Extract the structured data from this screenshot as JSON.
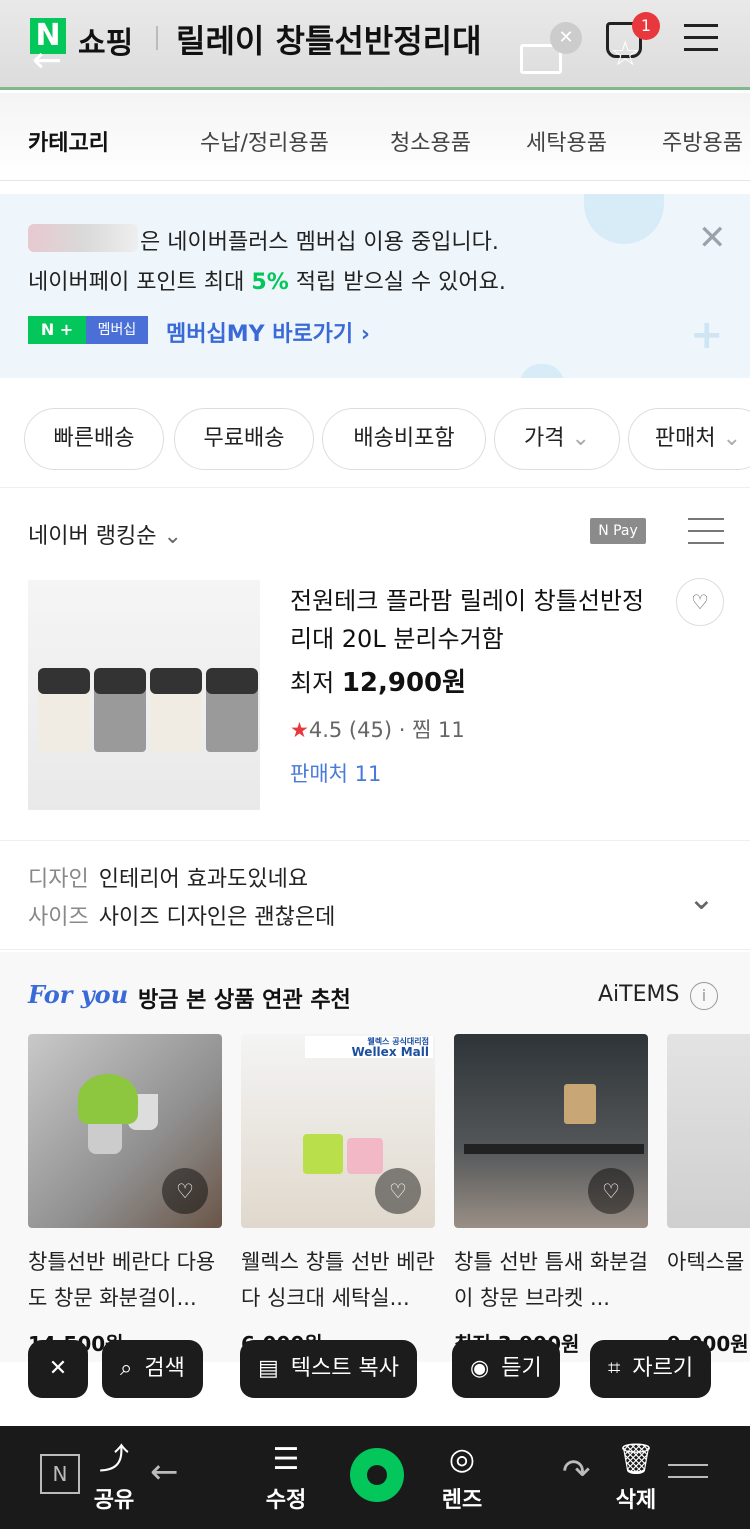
{
  "header": {
    "logo": "N",
    "shop": "쇼핑",
    "title": "릴레이 창틀선반정리대",
    "cart_count": "1",
    "cart_icon": "shopping-bag-icon",
    "accent": "#03c75a"
  },
  "categories": {
    "title": "카테고리",
    "items": [
      "수납/정리용품",
      "청소용품",
      "세탁용품",
      "주방용품"
    ]
  },
  "banner": {
    "line1": "은 네이버플러스 멤버십 이용 중입니다.",
    "line2_prefix": "네이버페이 포인트 최대",
    "line2_percent": "5%",
    "line2_suffix": "적립 받으실 수 있어요.",
    "badge_n": "N +",
    "badge_membership": "멤버십",
    "link": "멤버십MY 바로가기 ›"
  },
  "filters": [
    "빠른배송",
    "무료배송",
    "배송비포함",
    "가격",
    "판매처"
  ],
  "sort": {
    "label": "네이버 랭킹순",
    "npay": "N Pay"
  },
  "product": {
    "title": "전원테크 플라팜 릴레이 창틀선반정리대 20L 분리수거함",
    "price_label": "최저",
    "price": "12,900원",
    "rating": "4.5",
    "reviews": "(45)",
    "wish": "찜 11",
    "sellers": "판매처 11"
  },
  "reviews": [
    {
      "key": "디자인",
      "text": "인테리어 효과도있네요"
    },
    {
      "key": "사이즈",
      "text": "사이즈 디자인은 괜찮은데"
    }
  ],
  "foryou": {
    "logo": "For you",
    "title": "방금 본 상품 연관 추천",
    "brand": "AiTEMS",
    "cards": [
      {
        "title": "창틀선반 베란다 다용도 창문 화분걸이...",
        "price": "14,500원"
      },
      {
        "title": "웰렉스 창틀 선반 베란다 싱크대 세탁실...",
        "price": "6,000원"
      },
      {
        "title": "창틀 선반 틈새 화분걸이 창문 브라켓 ...",
        "price": "최저 3,990원"
      },
      {
        "title": "아텍스몰 다 화분 다",
        "price": "9,000원"
      }
    ],
    "wellex_sub": "웰렉스 공식대리점",
    "wellex": "Wellex Mall"
  },
  "actions": {
    "close": "✕",
    "search": "검색",
    "copy_text": "텍스트 복사",
    "listen": "듣기",
    "crop": "자르기"
  },
  "bottom_nav": {
    "share": "공유",
    "edit": "수정",
    "lens": "렌즈",
    "delete": "삭제"
  }
}
